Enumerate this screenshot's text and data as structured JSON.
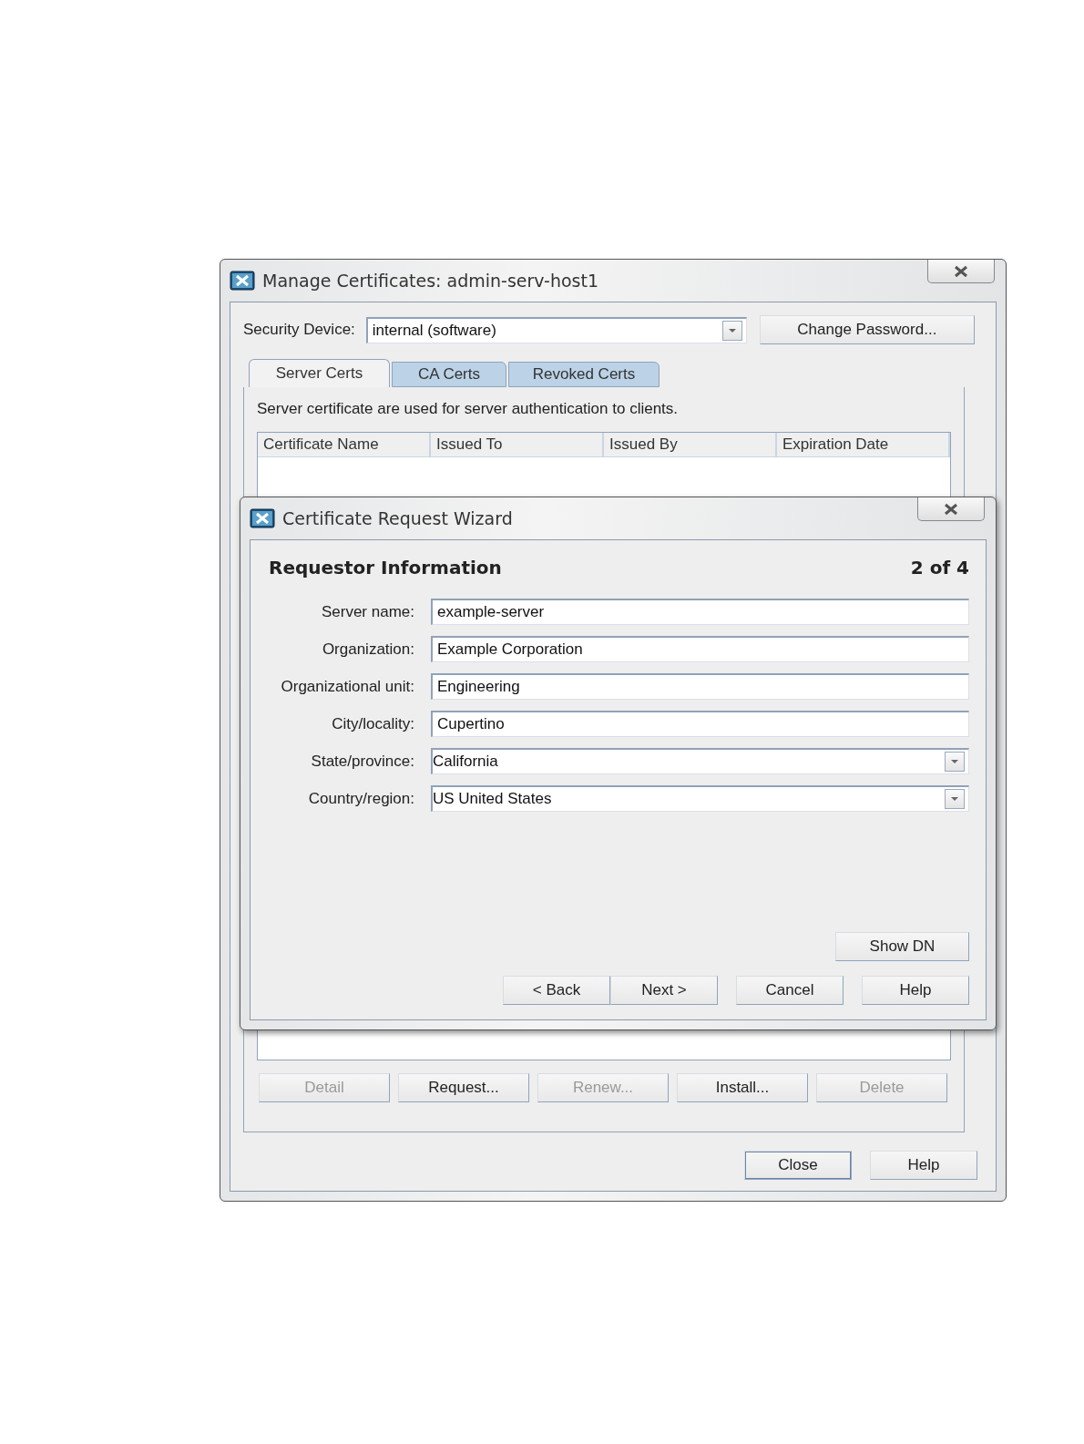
{
  "main_window": {
    "title": "Manage Certificates: admin-serv-host1",
    "security_device": {
      "label": "Security Device:",
      "value": "internal (software)"
    },
    "change_password": {
      "label": "Change Password..."
    },
    "tabs": [
      {
        "label": "Server Certs",
        "selected": true
      },
      {
        "label": "CA Certs",
        "selected": false
      },
      {
        "label": "Revoked Certs",
        "selected": false
      }
    ],
    "description": "Server certificate are used for server authentication to clients.",
    "table": {
      "columns": [
        "Certificate Name",
        "Issued To",
        "Issued By",
        "Expiration Date"
      ]
    },
    "actions": [
      {
        "label": "Detail",
        "disabled": true
      },
      {
        "label": "Request...",
        "disabled": false
      },
      {
        "label": "Renew...",
        "disabled": true
      },
      {
        "label": "Install...",
        "disabled": false
      },
      {
        "label": "Delete",
        "disabled": true
      }
    ],
    "buttons": [
      {
        "label": "Close",
        "default": true
      },
      {
        "label": "Help",
        "default": false
      }
    ]
  },
  "wizard": {
    "title": "Certificate Request Wizard",
    "heading": "Requestor Information",
    "step": "2 of 4",
    "fields": [
      {
        "kind": "text",
        "label": "Server name:",
        "value": "example-server"
      },
      {
        "kind": "text",
        "label": "Organization:",
        "value": "Example Corporation"
      },
      {
        "kind": "text",
        "label": "Organizational unit:",
        "value": "Engineering"
      },
      {
        "kind": "text",
        "label": "City/locality:",
        "value": "Cupertino"
      },
      {
        "kind": "select",
        "label": "State/province:",
        "value": "California"
      },
      {
        "kind": "select",
        "label": "Country/region:",
        "value": "US United States"
      }
    ],
    "show_dn": {
      "label": "Show DN"
    },
    "buttons": [
      {
        "label": "< Back"
      },
      {
        "label": "Next >"
      },
      {
        "label": "Cancel"
      },
      {
        "label": "Help"
      }
    ]
  }
}
